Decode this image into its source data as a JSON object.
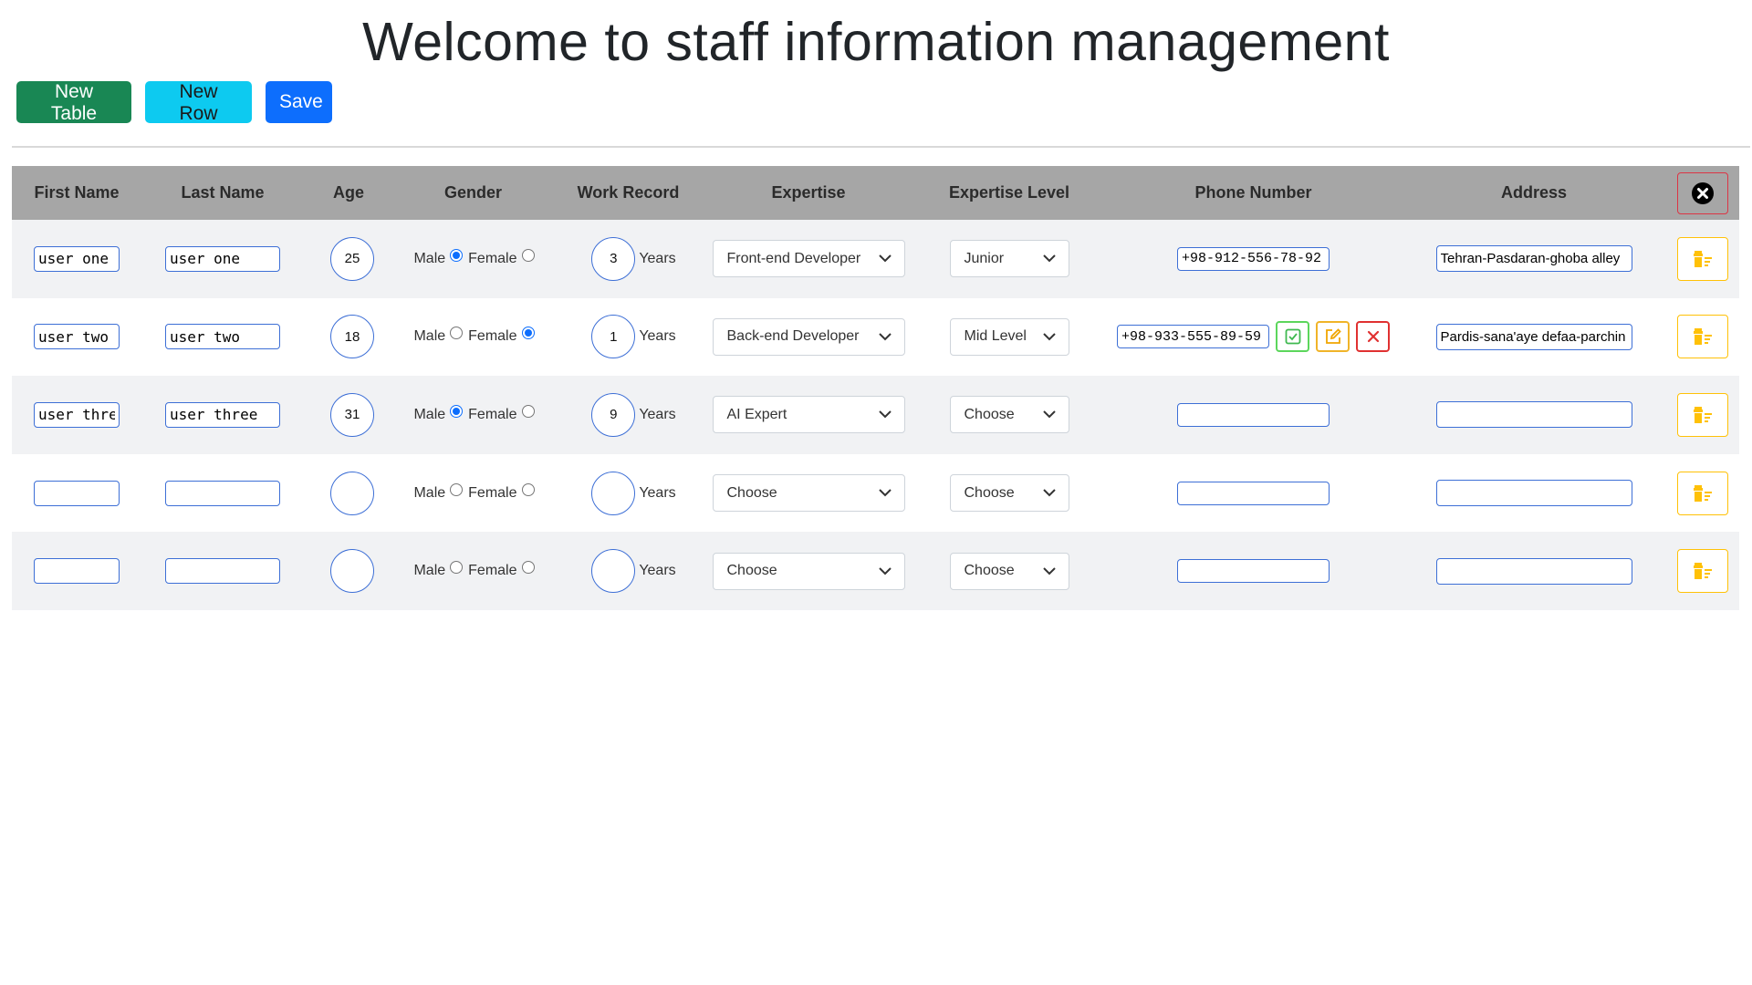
{
  "page": {
    "title": "Welcome to staff information management"
  },
  "toolbar": {
    "new_table": "New Table",
    "new_row": "New Row",
    "save": "Save"
  },
  "columns": [
    "First Name",
    "Last Name",
    "Age",
    "Gender",
    "Work Record",
    "Expertise",
    "Expertise Level",
    "Phone Number",
    "Address"
  ],
  "labels": {
    "male": "Male",
    "female": "Female",
    "years": "Years"
  },
  "rows": [
    {
      "first_name": "user one",
      "last_name": "user one",
      "age": "25",
      "gender": "Male",
      "work_record": "3",
      "expertise": "Front-end Developer",
      "level": "Junior",
      "phone": "+98-912-556-78-92",
      "address": "Tehran-Pasdaran-ghoba alley",
      "phone_actions": false
    },
    {
      "first_name": "user two",
      "last_name": "user two",
      "age": "18",
      "gender": "Female",
      "work_record": "1",
      "expertise": "Back-end Developer",
      "level": "Mid Level",
      "phone": "+98-933-555-89-59",
      "address": "Pardis-sana'aye defaa-parchin",
      "phone_actions": true
    },
    {
      "first_name": "user thre",
      "last_name": "user three",
      "age": "31",
      "gender": "Male",
      "work_record": "9",
      "expertise": "AI Expert",
      "level": "Choose",
      "phone": "",
      "address": "",
      "phone_actions": false
    },
    {
      "first_name": "",
      "last_name": "",
      "age": "",
      "gender": "",
      "work_record": "",
      "expertise": "Choose",
      "level": "Choose",
      "phone": "",
      "address": "",
      "phone_actions": false
    },
    {
      "first_name": "",
      "last_name": "",
      "age": "",
      "gender": "",
      "work_record": "",
      "expertise": "Choose",
      "level": "Choose",
      "phone": "",
      "address": "",
      "phone_actions": false
    }
  ],
  "icons": {
    "close_all": "x-circle-icon",
    "delete_row": "trash-icon",
    "confirm": "check-square-icon",
    "edit": "pencil-square-icon",
    "cancel": "x-icon",
    "dropdown": "chevron-down-icon"
  },
  "colors": {
    "header_bg": "#a6a6a6",
    "odd_row_bg": "#f1f2f4",
    "new_table": "#198754",
    "new_row": "#0dcaf0",
    "save": "#0d6efd",
    "input_border": "#3d6fd6",
    "delete_border": "#ffc107",
    "close_all_border": "#dc3545"
  }
}
